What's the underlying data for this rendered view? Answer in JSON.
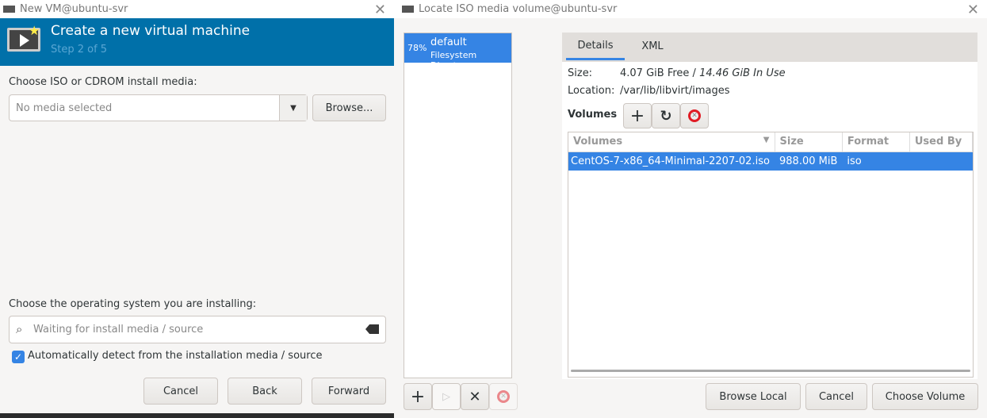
{
  "left": {
    "title": "New VM@ubuntu-svr",
    "banner_title": "Create a new virtual machine",
    "banner_step": "Step 2 of 5",
    "media_label": "Choose ISO or CDROM install media:",
    "media_placeholder": "No media selected",
    "browse": "Browse...",
    "os_label": "Choose the operating system you are installing:",
    "os_placeholder": "Waiting for install media / source",
    "auto_detect": "Automatically detect from the installation media / source",
    "auto_detect_checked": true,
    "cancel": "Cancel",
    "back": "Back",
    "forward": "Forward"
  },
  "right": {
    "title": "Locate ISO media volume@ubuntu-svr",
    "pool": {
      "percent": "78%",
      "name": "default",
      "type": "Filesystem Directory"
    },
    "tabs": [
      "Details",
      "XML"
    ],
    "size_label": "Size:",
    "size_free": "4.07 GiB Free /",
    "size_used": "14.46 GiB In Use",
    "location_label": "Location:",
    "location": "/var/lib/libvirt/images",
    "volumes_label": "Volumes",
    "columns": [
      "Volumes",
      "Size",
      "Format",
      "Used By"
    ],
    "rows": [
      {
        "name": "CentOS-7-x86_64-Minimal-2207-02.iso",
        "size": "988.00 MiB",
        "format": "iso",
        "used_by": ""
      }
    ],
    "browse_local": "Browse Local",
    "cancel": "Cancel",
    "choose": "Choose Volume"
  },
  "colors": {
    "banner": "#0070a9",
    "selection": "#3584e4"
  }
}
